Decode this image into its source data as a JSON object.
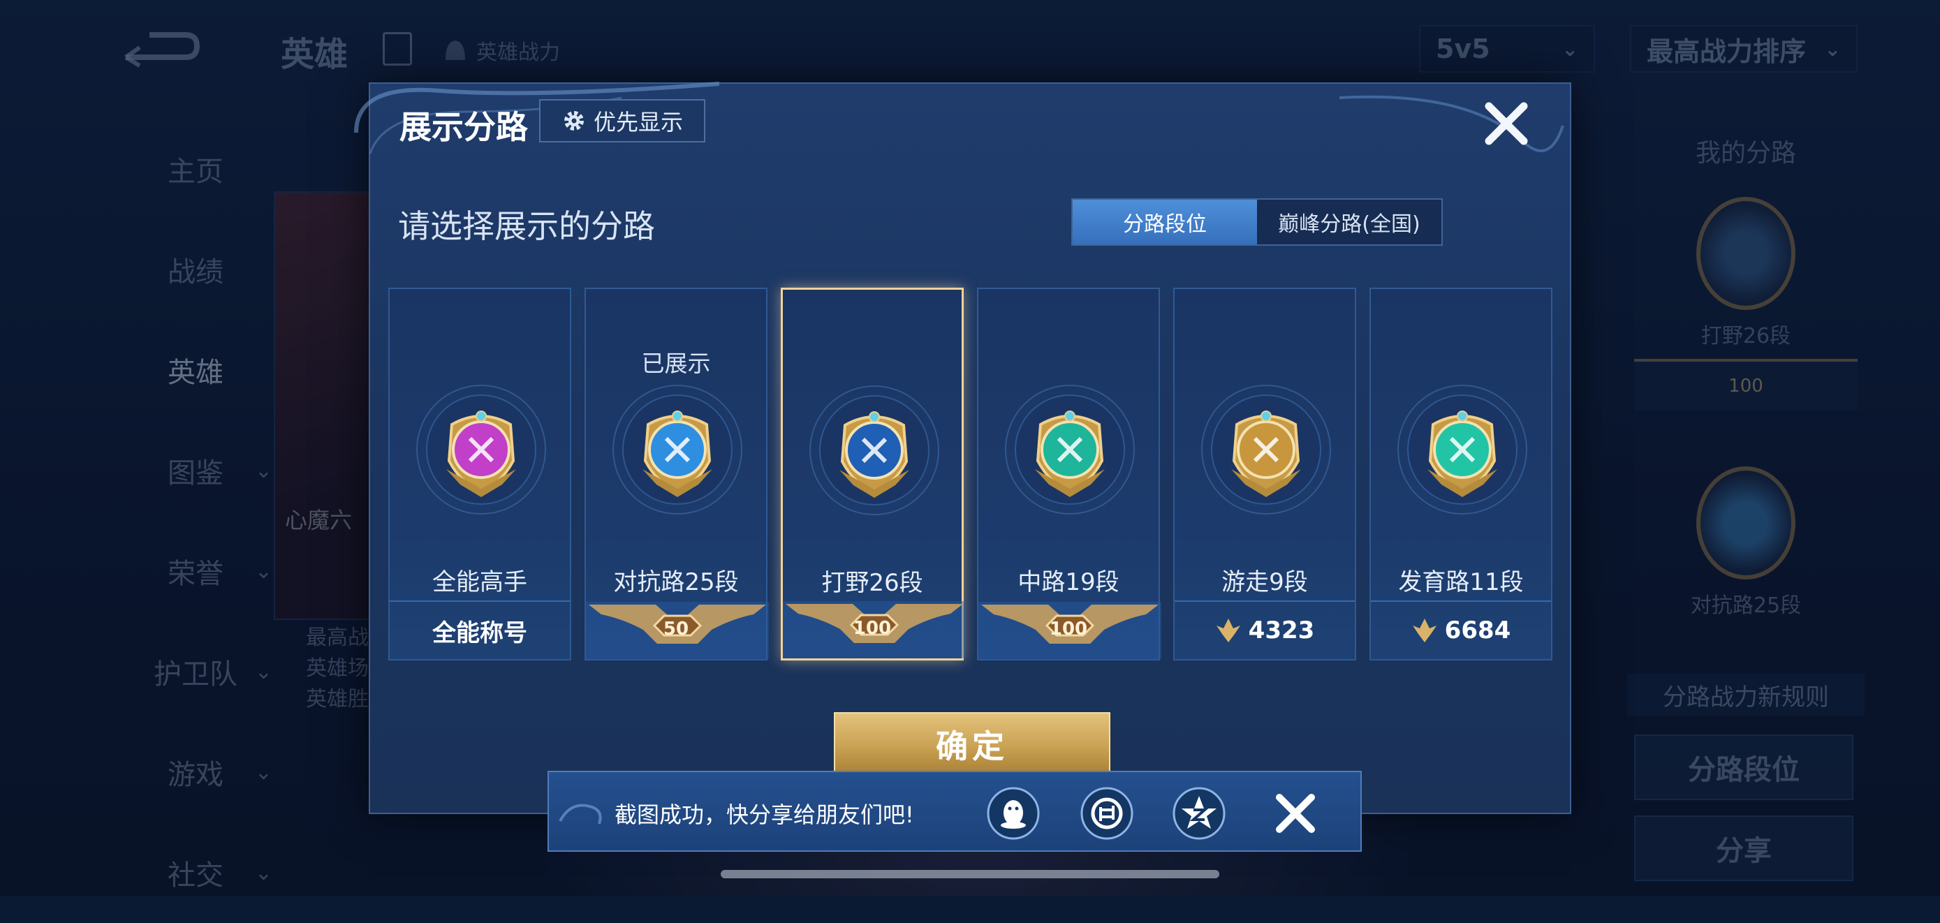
{
  "background": {
    "top_title": "英雄",
    "top_subtitle": "英雄战力",
    "mode_dropdown": "5v5",
    "sort_dropdown": "最高战力排序",
    "nav_items": [
      {
        "label": "主页",
        "has_chevron": false,
        "active": false
      },
      {
        "label": "战绩",
        "has_chevron": false,
        "active": false
      },
      {
        "label": "英雄",
        "has_chevron": false,
        "active": true
      },
      {
        "label": "图鉴",
        "has_chevron": true,
        "active": false
      },
      {
        "label": "荣誉",
        "has_chevron": true,
        "active": false
      },
      {
        "label": "护卫队",
        "has_chevron": true,
        "active": false
      },
      {
        "label": "游戏",
        "has_chevron": true,
        "active": false
      },
      {
        "label": "社交",
        "has_chevron": true,
        "active": false
      }
    ],
    "hero_card_name": "心魔六",
    "hero_stats": [
      "最高战",
      "英雄场",
      "英雄胜"
    ],
    "right_panel": {
      "title": "我的分路",
      "item1_label": "打野26段",
      "item1_rank": "100",
      "item2_label": "对抗路25段",
      "rule_button": "分路战力新规则",
      "lane_button": "分路段位",
      "share_button": "分享"
    }
  },
  "modal": {
    "title": "展示分路",
    "priority_button": "优先显示",
    "prompt": "请选择展示的分路",
    "tabs": [
      {
        "label": "分路段位",
        "active": true
      },
      {
        "label": "巅峰分路(全国)",
        "active": false
      }
    ],
    "lanes": [
      {
        "name": "全能高手",
        "status": "",
        "footer_type": "text",
        "footer_text": "全能称号",
        "selected": false,
        "badge_color": "#c23fc9"
      },
      {
        "name": "对抗路25段",
        "status": "已展示",
        "footer_type": "rank",
        "footer_text": "50",
        "selected": false,
        "badge_color": "#2e8fe0"
      },
      {
        "name": "打野26段",
        "status": "",
        "footer_type": "rank",
        "footer_text": "100",
        "selected": true,
        "badge_color": "#1f5fb5"
      },
      {
        "name": "中路19段",
        "status": "",
        "footer_type": "rank",
        "footer_text": "100",
        "selected": false,
        "badge_color": "#1fb59a"
      },
      {
        "name": "游走9段",
        "status": "",
        "footer_type": "score",
        "footer_text": "4323",
        "selected": false,
        "badge_color": "#c8963c"
      },
      {
        "name": "发育路11段",
        "status": "",
        "footer_type": "score",
        "footer_text": "6684",
        "selected": false,
        "badge_color": "#22c4a6"
      }
    ],
    "confirm_button": "确定"
  },
  "toast": {
    "message": "截图成功，快分享给朋友们吧!",
    "share_targets": [
      "qq-icon",
      "wechat-moments-icon",
      "qzone-icon"
    ]
  },
  "colors": {
    "accent_gold": "#f2d29a",
    "tab_active": "#3f80cc",
    "modal_bg": "#1b3560"
  }
}
